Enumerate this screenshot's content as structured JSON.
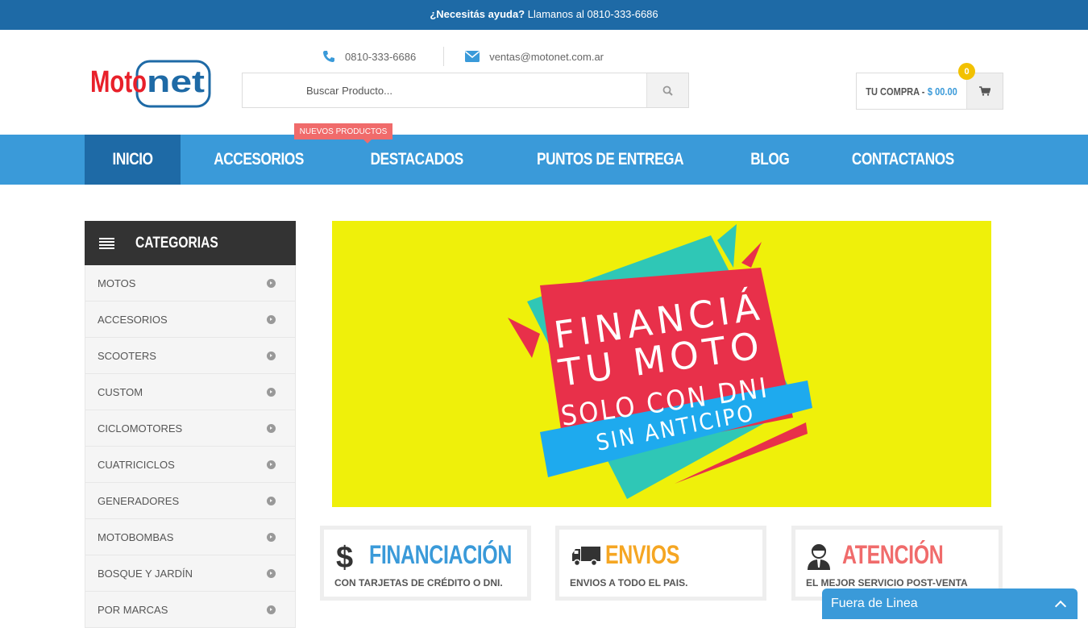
{
  "topbar": {
    "help_strong": "¿Necesitás ayuda?",
    "help_text": "Llamanos al 0810-333-6686"
  },
  "header": {
    "logo_text": "Motonet",
    "phone": "0810-333-6686",
    "email": "ventas@motonet.com.ar",
    "search_placeholder": "Buscar Producto...",
    "cart_label": "TU COMPRA -",
    "cart_amount": "$ 00.00",
    "cart_count": "0"
  },
  "nav": {
    "items": [
      {
        "label": "INICIO"
      },
      {
        "label": "ACCESORIOS"
      },
      {
        "label": "DESTACADOS"
      },
      {
        "label": "PUNTOS DE ENTREGA"
      },
      {
        "label": "BLOG"
      },
      {
        "label": "CONTACTANOS"
      }
    ],
    "badge": "NUEVOS PRODUCTOS"
  },
  "sidebar": {
    "title": "CATEGORIAS",
    "items": [
      {
        "label": "MOTOS"
      },
      {
        "label": "ACCESORIOS"
      },
      {
        "label": "SCOOTERS"
      },
      {
        "label": "CUSTOM"
      },
      {
        "label": "CICLOMOTORES"
      },
      {
        "label": "CUATRICICLOS"
      },
      {
        "label": "GENERADORES"
      },
      {
        "label": "MOTOBOMBAS"
      },
      {
        "label": "BOSQUE Y JARDÍN"
      },
      {
        "label": "POR MARCAS"
      }
    ]
  },
  "banner": {
    "line1": "FINANCIÁ",
    "line2": "TU MOTO",
    "line3": "SOLO CON DNI",
    "ribbon": "SIN ANTICIPO"
  },
  "features": [
    {
      "title": "FINANCIACIÓN",
      "subtitle": "CON TARJETAS DE CRÉDITO O DNI.",
      "color": "#3a9ad9",
      "icon": "dollar-icon"
    },
    {
      "title": "ENVIOS",
      "subtitle": "ENVIOS A TODO EL PAIS.",
      "color": "#f5a623",
      "icon": "truck-icon"
    },
    {
      "title": "ATENCIÓN",
      "subtitle": "EL MEJOR SERVICIO POST-VENTA",
      "color": "#f06b6b",
      "icon": "support-agent-icon"
    }
  ],
  "chat": {
    "label": "Fuera de Linea"
  },
  "colors": {
    "primary": "#3a9ad9",
    "dark_blue": "#1e6aa6",
    "banner_bg": "#eff00a",
    "badge": "#f06b6b"
  }
}
